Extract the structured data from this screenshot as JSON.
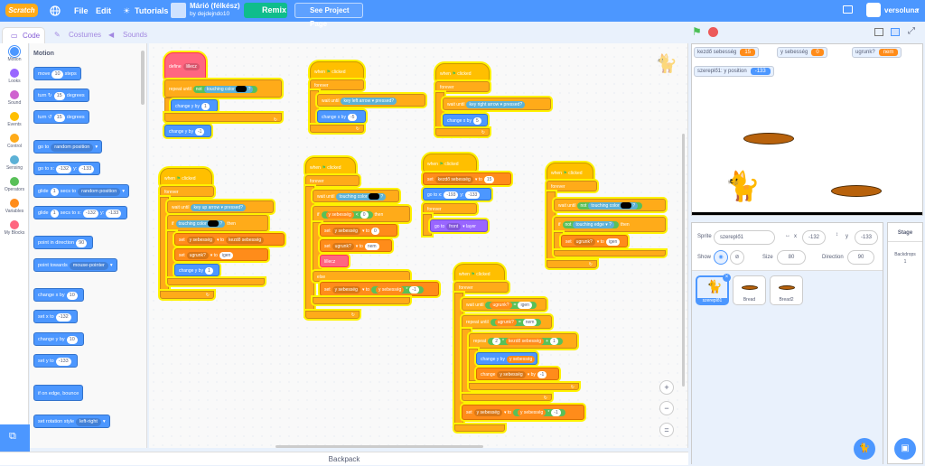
{
  "menu": {
    "logo": "Scratch",
    "file": "File",
    "edit": "Edit",
    "tutorials": "Tutorials",
    "project_title": "Márió (félkész)",
    "author": "by dejdejndo10",
    "remix": "Remix",
    "see_project": "See Project Page",
    "username": "versoluna"
  },
  "tabs": {
    "code": "Code",
    "costumes": "Costumes",
    "sounds": "Sounds"
  },
  "categories": [
    {
      "label": "Motion",
      "color": "#4c97ff"
    },
    {
      "label": "Looks",
      "color": "#9966ff"
    },
    {
      "label": "Sound",
      "color": "#cf63cf"
    },
    {
      "label": "Events",
      "color": "#ffbf00"
    },
    {
      "label": "Control",
      "color": "#ffab19"
    },
    {
      "label": "Sensing",
      "color": "#5cb1d6"
    },
    {
      "label": "Operators",
      "color": "#59c059"
    },
    {
      "label": "Variables",
      "color": "#ff8c1a"
    },
    {
      "label": "My Blocks",
      "color": "#ff6680"
    }
  ],
  "palette": {
    "heading": "Motion",
    "move": "move",
    "move_n": "10",
    "steps": "steps",
    "turn": "turn",
    "turn_n": "15",
    "degrees": "degrees",
    "turn2_n": "15",
    "degrees2": "degrees",
    "goto": "go to",
    "goto_dd": "random position",
    "gotoxy": "go to x:",
    "gotoxy_x": "-132",
    "gotoxy_y_lbl": "y:",
    "gotoxy_y": "-133",
    "glide": "glide",
    "glide_n": "1",
    "secs_to": "secs to",
    "glide_dd": "random position",
    "glide2_n": "1",
    "glide2_lbl": "secs to x:",
    "glide2_x": "-132",
    "glide2_y_lbl": "y:",
    "glide2_y": "-133",
    "point_dir": "point in direction",
    "point_dir_n": "90",
    "point_towards": "point towards",
    "point_towards_dd": "mouse-pointer",
    "change_x": "change x by",
    "change_x_n": "10",
    "set_x": "set x to",
    "set_x_n": "-132",
    "change_y": "change y by",
    "change_y_n": "10",
    "set_y": "set y to",
    "set_y_n": "-133",
    "bounce": "if on edge, bounce",
    "rot_style": "set rotation style",
    "rot_style_dd": "left-right"
  },
  "code": {
    "s1": {
      "define": "define",
      "name": "lillecz",
      "repeat_until": "repeat until",
      "not": "not",
      "touching_color": "touching color",
      "q": "?",
      "change_y": "change y by",
      "v1": "1",
      "change_y2": "change y by",
      "v2": "-1"
    },
    "s2": {
      "hat": "when",
      "clicked": "clicked",
      "forever": "forever",
      "wait_until": "wait until",
      "key": "key",
      "key_dd": "left arrow",
      "pressed": "pressed?",
      "change_x": "change x by",
      "v": "-5"
    },
    "s3": {
      "hat": "when",
      "clicked": "clicked",
      "forever": "forever",
      "wait_until": "wait until",
      "key": "key",
      "key_dd": "right arrow",
      "pressed": "pressed?",
      "change_x": "change x by",
      "v": "5"
    },
    "s4": {
      "hat": "when",
      "clicked": "clicked",
      "forever": "forever",
      "wait_until": "wait until",
      "key": "key",
      "key_dd": "up arrow",
      "pressed": "pressed?",
      "if": "if",
      "touching_color": "touching color",
      "q": "?",
      "then": "then",
      "set": "set",
      "var1": "y sebesség",
      "to": "to",
      "val1": "kezdő sebesség",
      "set2": "set",
      "var2": "ugrunk?",
      "to2": "to",
      "val2": "igen",
      "change_y": "change y by",
      "v": "1"
    },
    "s5": {
      "hat": "when",
      "clicked": "clicked",
      "forever": "forever",
      "wait_until": "wait until",
      "touching_color": "touching color",
      "q": "?",
      "if": "if",
      "var": "y sebesség",
      "lt": "<",
      "zero": "0",
      "then": "then",
      "set": "set",
      "var1": "y sebesség",
      "to": "to",
      "val1": "0",
      "set2": "set",
      "var2": "ugrunk?",
      "to2": "to",
      "val2": "nem",
      "call": "lillecz",
      "else": "else",
      "set3": "set",
      "var3": "y sebesség",
      "to3": "to",
      "op_var": "y sebesség",
      "op": "*",
      "op_n": "-1"
    },
    "s6": {
      "hat": "when",
      "clicked": "clicked",
      "set": "set",
      "var": "kezdő sebesség",
      "to": "to",
      "val": "15",
      "goto": "go to x:",
      "x": "-193",
      "y_lbl": "y:",
      "y": "-133",
      "forever": "forever",
      "goto_front": "go to",
      "front": "front",
      "layer": "layer"
    },
    "s7": {
      "hat": "when",
      "clicked": "clicked",
      "forever": "forever",
      "wait_until": "wait until",
      "not": "not",
      "touching_color": "touching color",
      "q": "?",
      "if": "if",
      "not2": "not",
      "touching": "touching",
      "edge": "edge",
      "q2": "?",
      "then": "then",
      "set": "set",
      "var": "ugrunk?",
      "to": "to",
      "val": "igen"
    },
    "s8": {
      "hat": "when",
      "clicked": "clicked",
      "forever": "forever",
      "wait_until": "wait until",
      "var": "ugrunk?",
      "eq": "=",
      "val": "igen",
      "repeat_until": "repeat until",
      "var2": "ugrunk?",
      "eq2": "=",
      "val2": "nem",
      "repeat": "repeat",
      "n2": "2",
      "times": "*",
      "kvar": "kezdő sebesség",
      "plus": "+",
      "one": "1",
      "change_y": "change y by",
      "yvar": "y sebesség",
      "change": "change",
      "cvar": "y sebesség",
      "by": "by",
      "cval": "-1",
      "set": "set",
      "svar": "y sebesség",
      "to": "to",
      "op_var": "y sebesség",
      "op": "*",
      "op_n": "-1"
    }
  },
  "monitors": [
    {
      "label": "kezdő sebesség",
      "value": "15"
    },
    {
      "label": "y sebesség",
      "value": "0"
    },
    {
      "label": "ugrunk?",
      "value": "nem"
    },
    {
      "label": "szereplő1: y position",
      "value": "-133"
    }
  ],
  "sprite_info": {
    "sprite_lbl": "Sprite",
    "name": "szereplő1",
    "x_lbl": "x",
    "x": "-132",
    "y_lbl": "y",
    "y": "-133",
    "show_lbl": "Show",
    "size_lbl": "Size",
    "size": "80",
    "dir_lbl": "Direction",
    "dir": "90"
  },
  "sprites": [
    {
      "name": "szereplő1"
    },
    {
      "name": "Bread"
    },
    {
      "name": "Bread2"
    }
  ],
  "stage": {
    "title": "Stage",
    "backdrops_lbl": "Backdrops",
    "backdrops_n": "1"
  },
  "backpack": "Backpack",
  "zoom": {
    "in": "+",
    "out": "−",
    "reset": "="
  }
}
